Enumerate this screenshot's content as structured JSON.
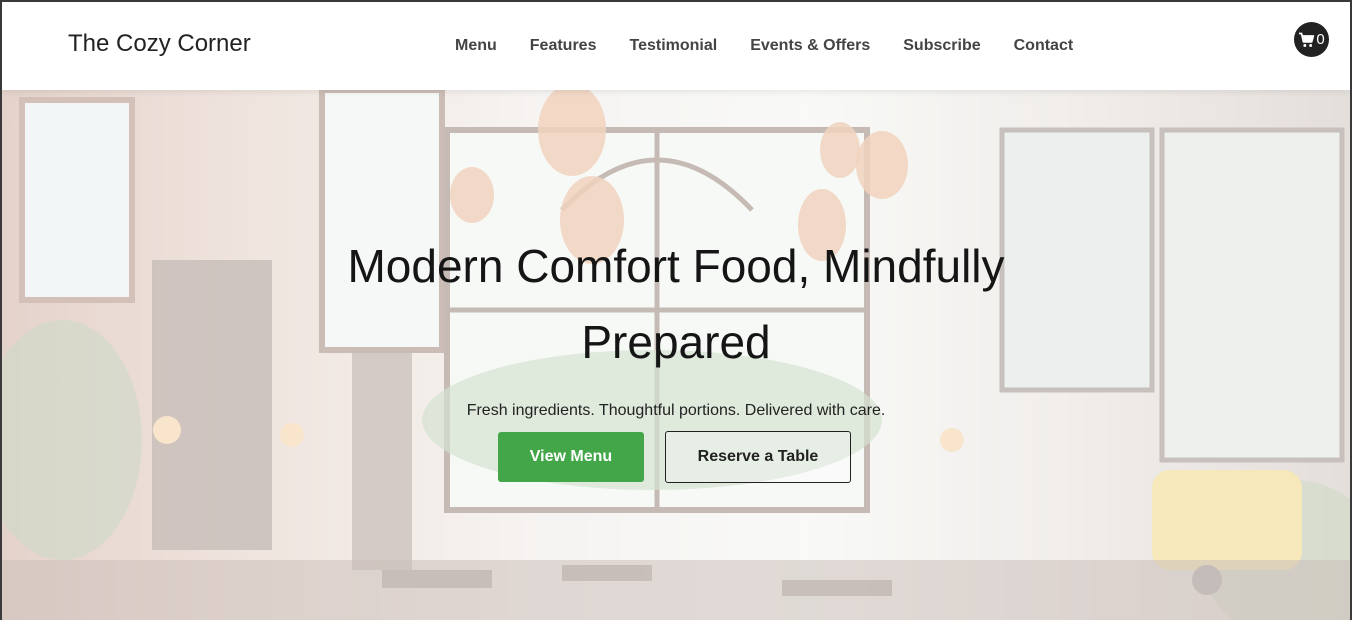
{
  "header": {
    "brand": "The Cozy Corner",
    "nav": [
      "Menu",
      "Features",
      "Testimonial",
      "Events & Offers",
      "Subscribe",
      "Contact"
    ],
    "cart": {
      "icon": "cart-icon",
      "count": "0"
    }
  },
  "hero": {
    "title_line1": "Modern Comfort Food, Mindfully",
    "title_line2": "Prepared",
    "subtitle": "Fresh ingredients. Thoughtful portions. Delivered with care.",
    "primary_button": "View Menu",
    "secondary_button": "Reserve a Table"
  },
  "colors": {
    "primary_button": "#43a648",
    "text_dark": "#151515",
    "cart_badge": "#222222"
  }
}
